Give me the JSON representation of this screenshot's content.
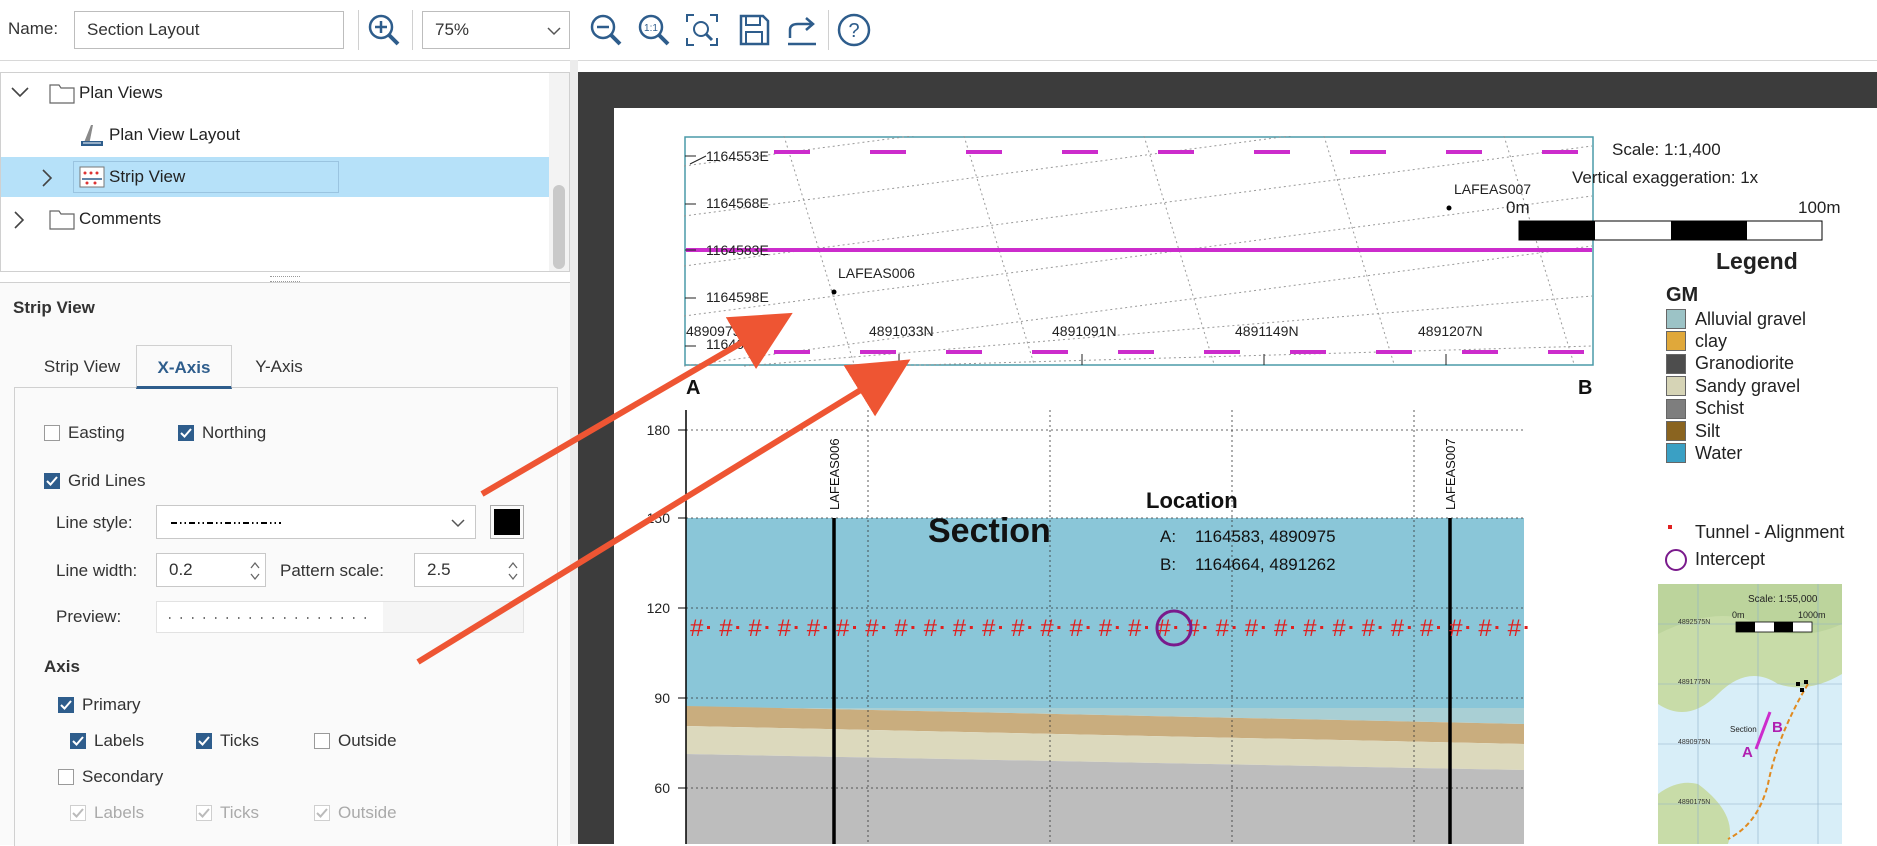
{
  "toolbar": {
    "name_label": "Name:",
    "name_value": "Section Layout",
    "zoom_value": "75%",
    "zoom_in_icon": "zoom-in-icon",
    "zoom_out_icon": "zoom-out-icon"
  },
  "tree": {
    "items": [
      {
        "label": "Plan Views",
        "icon": "folder-icon",
        "expanded": true
      },
      {
        "label": "Plan View Layout",
        "icon": "layout-icon"
      },
      {
        "label": "Strip View",
        "icon": "strip-view-icon",
        "selected": true
      },
      {
        "label": "Comments",
        "icon": "folder-icon",
        "expanded": false
      }
    ]
  },
  "props": {
    "title": "Strip View",
    "tabs": [
      {
        "label": "Strip View"
      },
      {
        "label": "X-Axis",
        "active": true
      },
      {
        "label": "Y-Axis"
      }
    ],
    "easting_label": "Easting",
    "northing_label": "Northing",
    "gridlines_label": "Grid Lines",
    "linestyle_label": "Line style:",
    "linewidth_label": "Line width:",
    "linewidth_value": "0.2",
    "patternscale_label": "Pattern scale:",
    "patternscale_value": "2.5",
    "preview_label": "Preview:",
    "axis_heading": "Axis",
    "primary_label": "Primary",
    "labels_label": "Labels",
    "ticks_label": "Ticks",
    "outside_label": "Outside",
    "secondary_label": "Secondary",
    "sec_labels_label": "Labels",
    "sec_ticks_label": "Ticks",
    "sec_outside_label": "Outside",
    "line_color": "#000000"
  },
  "plan": {
    "easting_labels": [
      "1164553E",
      "1164568E",
      "1164583E",
      "1164598E",
      "1164613E"
    ],
    "northing_labels": [
      "4890975N",
      "4891033N",
      "4891091N",
      "4891149N",
      "4891207N"
    ],
    "holes": [
      "LAFEAS006",
      "LAFEAS007"
    ],
    "end_a": "A",
    "end_b": "B"
  },
  "scale": {
    "scale_text": "Scale: 1:1,400",
    "vert_exag": "Vertical exaggeration: 1x",
    "bar_start": "0m",
    "bar_end": "100m"
  },
  "legend": {
    "title": "Legend",
    "group": "GM",
    "items": [
      {
        "label": "Alluvial gravel",
        "color": "#9cc3c6"
      },
      {
        "label": "clay",
        "color": "#e0a83a"
      },
      {
        "label": "Granodiorite",
        "color": "#4d4d4d"
      },
      {
        "label": "Sandy gravel",
        "color": "#d6d4b6"
      },
      {
        "label": "Schist",
        "color": "#7e7e7e"
      },
      {
        "label": "Silt",
        "color": "#8a6420"
      },
      {
        "label": "Water",
        "color": "#3aa0c4"
      }
    ],
    "tunnel_label": "Tunnel - Alignment",
    "intercept_label": "Intercept"
  },
  "section": {
    "title": "Section",
    "y_ticks": [
      "180",
      "150",
      "120",
      "90",
      "60"
    ],
    "location_title": "Location",
    "loc_a_key": "A:",
    "loc_a_val": "1164583, 4890975",
    "loc_b_key": "B:",
    "loc_b_val": "1164664, 4891262",
    "holes": [
      "LAFEAS006",
      "LAFEAS007"
    ]
  },
  "inset": {
    "scale_text": "Scale: 1:55,000",
    "bar_start": "0m",
    "bar_end": "1000m",
    "n_labels": [
      "4892575N",
      "4891775N",
      "4890975N",
      "4890175N"
    ],
    "section_label": "Section",
    "a": "A",
    "b": "B"
  }
}
